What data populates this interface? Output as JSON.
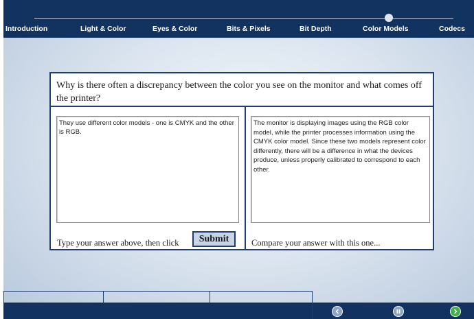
{
  "nav": {
    "items": [
      {
        "label": "Introduction"
      },
      {
        "label": "Light & Color"
      },
      {
        "label": "Eyes & Color"
      },
      {
        "label": "Bits & Pixels"
      },
      {
        "label": "Bit Depth"
      },
      {
        "label": "Color Models"
      },
      {
        "label": "Codecs"
      }
    ],
    "current": "Color Models"
  },
  "question": {
    "text": "Why is there often a discrepancy between the color you see on the monitor and what comes off the printer?"
  },
  "answer": {
    "value": "They use different color models - one is CMYK and the other is RGB.",
    "instruction": "Type your answer above, then click",
    "submit_label": "Submit"
  },
  "model_answer": {
    "text": "The monitor is displaying images using the RGB color model, while the printer processes information using the CMYK color model.  Since these two models represent color differently, there will be a difference in what the devices produce, unless properly calibrated to correspond to each other.",
    "caption": "Compare your answer with this one..."
  },
  "controls": {
    "back_icon": "chevron-left-icon",
    "pause_icon": "pause-icon",
    "next_icon": "chevron-right-icon"
  },
  "colors": {
    "navy": "#12325f",
    "border": "#1f3d6e",
    "next_green": "#44b04a"
  }
}
